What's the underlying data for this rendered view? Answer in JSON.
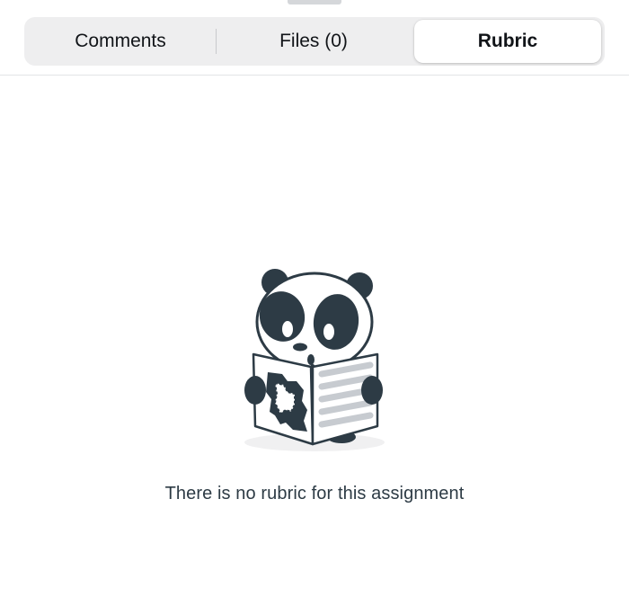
{
  "tabs": [
    {
      "label": "Comments",
      "selected": false
    },
    {
      "label": "Files (0)",
      "selected": false
    },
    {
      "label": "Rubric",
      "selected": true
    }
  ],
  "empty_state": {
    "illustration": "panda-reading-newspaper",
    "message": "There is no rubric for this assignment"
  },
  "colors": {
    "segment_background": "#eeeeef",
    "selected_segment": "#ffffff",
    "message_text": "#2d3b45",
    "panda_dark": "#2d3b45"
  }
}
